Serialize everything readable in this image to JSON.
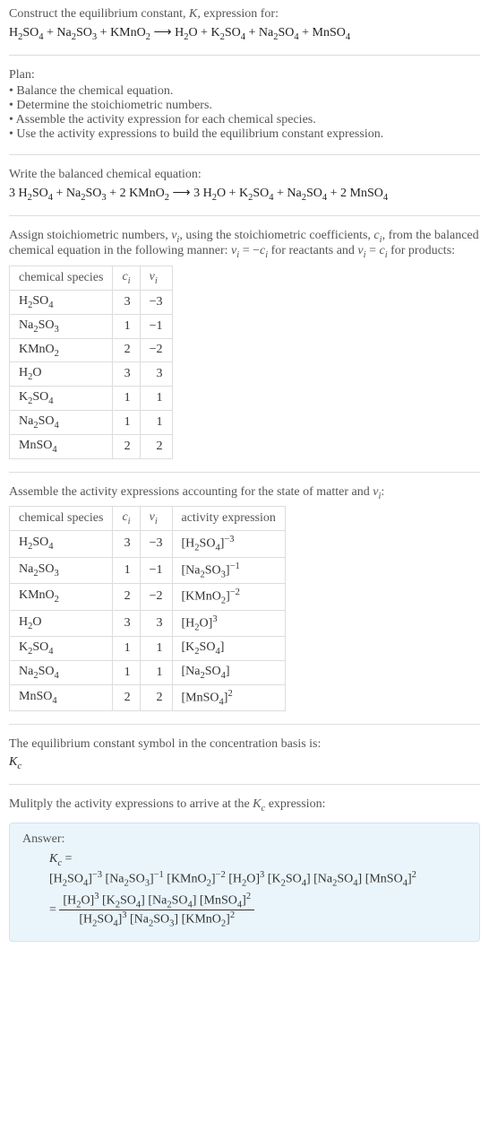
{
  "intro": {
    "heading_html": "Construct the equilibrium constant, <span class=\"ital\">K</span>, expression for:",
    "reaction_html": "H<span class=\"sub\">2</span>SO<span class=\"sub\">4</span> + Na<span class=\"sub\">2</span>SO<span class=\"sub\">3</span> + KMnO<span class=\"sub\">2</span> ⟶ H<span class=\"sub\">2</span>O + K<span class=\"sub\">2</span>SO<span class=\"sub\">4</span> + Na<span class=\"sub\">2</span>SO<span class=\"sub\">4</span> + MnSO<span class=\"sub\">4</span>"
  },
  "plan": {
    "title": "Plan:",
    "bullets": [
      "• Balance the chemical equation.",
      "• Determine the stoichiometric numbers.",
      "• Assemble the activity expression for each chemical species.",
      "• Use the activity expressions to build the equilibrium constant expression."
    ]
  },
  "balanced": {
    "heading": "Write the balanced chemical equation:",
    "equation_html": "3 H<span class=\"sub\">2</span>SO<span class=\"sub\">4</span> + Na<span class=\"sub\">2</span>SO<span class=\"sub\">3</span> + 2 KMnO<span class=\"sub\">2</span> ⟶ 3 H<span class=\"sub\">2</span>O + K<span class=\"sub\">2</span>SO<span class=\"sub\">4</span> + Na<span class=\"sub\">2</span>SO<span class=\"sub\">4</span> + 2 MnSO<span class=\"sub\">4</span>"
  },
  "stoich": {
    "intro_html": "Assign stoichiometric numbers, <span class=\"ital\">ν<span class=\"sub\">i</span></span>, using the stoichiometric coefficients, <span class=\"ital\">c<span class=\"sub\">i</span></span>, from the balanced chemical equation in the following manner: <span class=\"ital\">ν<span class=\"sub\">i</span></span> = −<span class=\"ital\">c<span class=\"sub\">i</span></span> for reactants and <span class=\"ital\">ν<span class=\"sub\">i</span></span> = <span class=\"ital\">c<span class=\"sub\">i</span></span> for products:",
    "headers": {
      "species": "chemical species",
      "ci_html": "<span class=\"ital\">c<span class=\"sub\">i</span></span>",
      "vi_html": "<span class=\"ital\">ν<span class=\"sub\">i</span></span>"
    },
    "rows": [
      {
        "species_html": "H<span class=\"sub\">2</span>SO<span class=\"sub\">4</span>",
        "ci": "3",
        "vi": "−3"
      },
      {
        "species_html": "Na<span class=\"sub\">2</span>SO<span class=\"sub\">3</span>",
        "ci": "1",
        "vi": "−1"
      },
      {
        "species_html": "KMnO<span class=\"sub\">2</span>",
        "ci": "2",
        "vi": "−2"
      },
      {
        "species_html": "H<span class=\"sub\">2</span>O",
        "ci": "3",
        "vi": "3"
      },
      {
        "species_html": "K<span class=\"sub\">2</span>SO<span class=\"sub\">4</span>",
        "ci": "1",
        "vi": "1"
      },
      {
        "species_html": "Na<span class=\"sub\">2</span>SO<span class=\"sub\">4</span>",
        "ci": "1",
        "vi": "1"
      },
      {
        "species_html": "MnSO<span class=\"sub\">4</span>",
        "ci": "2",
        "vi": "2"
      }
    ]
  },
  "activity": {
    "intro_html": "Assemble the activity expressions accounting for the state of matter and <span class=\"ital\">ν<span class=\"sub\">i</span></span>:",
    "headers": {
      "species": "chemical species",
      "ci_html": "<span class=\"ital\">c<span class=\"sub\">i</span></span>",
      "vi_html": "<span class=\"ital\">ν<span class=\"sub\">i</span></span>",
      "expr": "activity expression"
    },
    "rows": [
      {
        "species_html": "H<span class=\"sub\">2</span>SO<span class=\"sub\">4</span>",
        "ci": "3",
        "vi": "−3",
        "expr_html": "[H<span class=\"sub\">2</span>SO<span class=\"sub\">4</span>]<span class=\"sup\">−3</span>"
      },
      {
        "species_html": "Na<span class=\"sub\">2</span>SO<span class=\"sub\">3</span>",
        "ci": "1",
        "vi": "−1",
        "expr_html": "[Na<span class=\"sub\">2</span>SO<span class=\"sub\">3</span>]<span class=\"sup\">−1</span>"
      },
      {
        "species_html": "KMnO<span class=\"sub\">2</span>",
        "ci": "2",
        "vi": "−2",
        "expr_html": "[KMnO<span class=\"sub\">2</span>]<span class=\"sup\">−2</span>"
      },
      {
        "species_html": "H<span class=\"sub\">2</span>O",
        "ci": "3",
        "vi": "3",
        "expr_html": "[H<span class=\"sub\">2</span>O]<span class=\"sup\">3</span>"
      },
      {
        "species_html": "K<span class=\"sub\">2</span>SO<span class=\"sub\">4</span>",
        "ci": "1",
        "vi": "1",
        "expr_html": "[K<span class=\"sub\">2</span>SO<span class=\"sub\">4</span>]"
      },
      {
        "species_html": "Na<span class=\"sub\">2</span>SO<span class=\"sub\">4</span>",
        "ci": "1",
        "vi": "1",
        "expr_html": "[Na<span class=\"sub\">2</span>SO<span class=\"sub\">4</span>]"
      },
      {
        "species_html": "MnSO<span class=\"sub\">4</span>",
        "ci": "2",
        "vi": "2",
        "expr_html": "[MnSO<span class=\"sub\">4</span>]<span class=\"sup\">2</span>"
      }
    ]
  },
  "symbol": {
    "line1": "The equilibrium constant symbol in the concentration basis is:",
    "line2_html": "<span class=\"ital\">K<span class=\"sub\">c</span></span>"
  },
  "multiply": {
    "text_html": "Mulitply the activity expressions to arrive at the <span class=\"ital\">K<span class=\"sub\">c</span></span> expression:"
  },
  "answer": {
    "label": "Answer:",
    "line1_html": "<span class=\"ital\">K<span class=\"sub\">c</span></span> =",
    "line2_html": "[H<span class=\"sub\">2</span>SO<span class=\"sub\">4</span>]<span class=\"sup\">−3</span> [Na<span class=\"sub\">2</span>SO<span class=\"sub\">3</span>]<span class=\"sup\">−1</span> [KMnO<span class=\"sub\">2</span>]<span class=\"sup\">−2</span> [H<span class=\"sub\">2</span>O]<span class=\"sup\">3</span> [K<span class=\"sub\">2</span>SO<span class=\"sub\">4</span>] [Na<span class=\"sub\">2</span>SO<span class=\"sub\">4</span>] [MnSO<span class=\"sub\">4</span>]<span class=\"sup\">2</span>",
    "eq_prefix": "= ",
    "frac_num_html": "[H<span class=\"sub\">2</span>O]<span class=\"sup\">3</span> [K<span class=\"sub\">2</span>SO<span class=\"sub\">4</span>] [Na<span class=\"sub\">2</span>SO<span class=\"sub\">4</span>] [MnSO<span class=\"sub\">4</span>]<span class=\"sup\">2</span>",
    "frac_den_html": "[H<span class=\"sub\">2</span>SO<span class=\"sub\">4</span>]<span class=\"sup\">3</span> [Na<span class=\"sub\">2</span>SO<span class=\"sub\">3</span>] [KMnO<span class=\"sub\">2</span>]<span class=\"sup\">2</span>"
  }
}
